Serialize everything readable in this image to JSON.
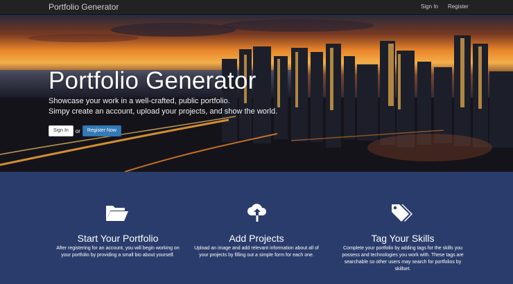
{
  "navbar": {
    "brand": "Portfolio Generator",
    "links": {
      "signin": "Sign In",
      "register": "Register"
    }
  },
  "hero": {
    "title": "Portfolio Generator",
    "subtitle_line1": "Showcase your work in a well-crafted, public portfolio.",
    "subtitle_line2": "Simpy create an account, upload your projects, and show the world.",
    "signin_button": "Sign In",
    "or_text": "or",
    "register_button": "Register Now"
  },
  "features": [
    {
      "icon": "folder-open-icon",
      "title": "Start Your Portfolio",
      "text": "After registering for an account, you will begin working on your portfolio by providing a small bio about yourself."
    },
    {
      "icon": "cloud-upload-icon",
      "title": "Add Projects",
      "text": "Upload an image and add relevant information about all of your projects by filling out a simple form for each one."
    },
    {
      "icon": "tags-icon",
      "title": "Tag Your Skills",
      "text": "Complete your portfolio by adding tags for the skills you possess and technologies you work with. These tags are searchable so other users may search for portfolios by skillset."
    }
  ],
  "colors": {
    "navbar": "#222222",
    "features_bg": "#2a3c6b",
    "primary_button": "#337ab7"
  }
}
